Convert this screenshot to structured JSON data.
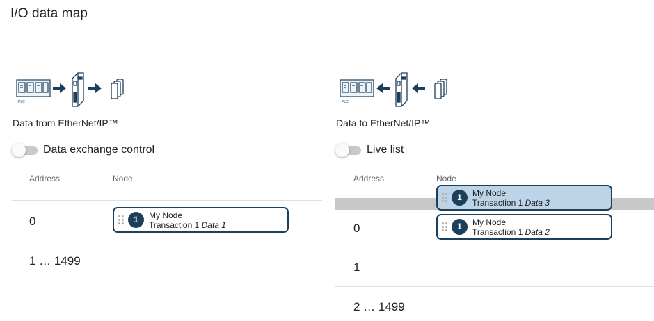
{
  "page": {
    "title": "I/O data map"
  },
  "left": {
    "direction_label": "Data from EtherNet/IP™",
    "toggle_label": "Data exchange control",
    "columns": {
      "address": "Address",
      "node": "Node"
    },
    "rows": [
      {
        "address": "0"
      },
      {
        "address": "1 … 1499"
      }
    ],
    "chips": [
      {
        "badge": "1",
        "name": "My Node",
        "transaction": "Transaction 1",
        "data": "Data 1"
      }
    ],
    "diagram": {
      "plc_caption": "PLC"
    }
  },
  "right": {
    "direction_label": "Data to EtherNet/IP™",
    "toggle_label": "Live list",
    "columns": {
      "address": "Address",
      "node": "Node"
    },
    "rows": [
      {
        "address": "0"
      },
      {
        "address": "1"
      },
      {
        "address": "2 … 1499"
      }
    ],
    "chips": [
      {
        "badge": "1",
        "name": "My Node",
        "transaction": "Transaction 1",
        "data": "Data 3",
        "state": "dragging"
      },
      {
        "badge": "1",
        "name": "My Node",
        "transaction": "Transaction 1",
        "data": "Data 2"
      }
    ],
    "diagram": {
      "plc_caption": "PLC"
    }
  },
  "colors": {
    "accent": "#1c3f5c",
    "drag_highlight": "#bcd3e8",
    "drop_indicator": "#c8c8c8"
  },
  "icons": [
    "plc-icon",
    "arrow-right-icon",
    "arrow-left-icon",
    "gateway-device-icon",
    "devices-stack-icon",
    "drag-handle-icon"
  ]
}
